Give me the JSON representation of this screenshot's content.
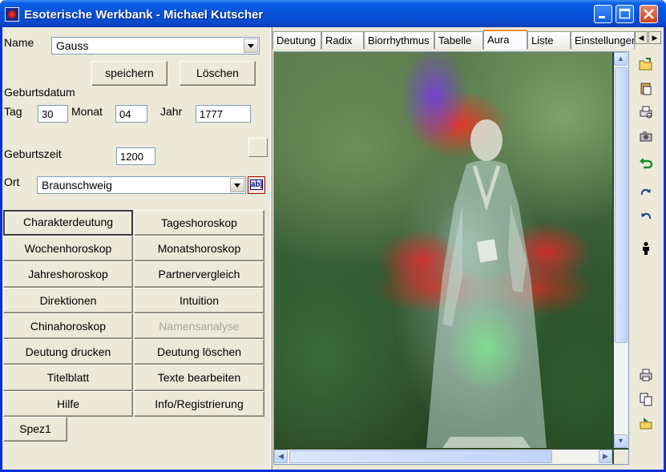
{
  "window": {
    "title": "Esoterische Werkbank - Michael Kutscher"
  },
  "form": {
    "name_label": "Name",
    "name_value": "Gauss",
    "save_label": "speichern",
    "delete_label": "Löschen",
    "birthdate_label": "Geburtsdatum",
    "day_label": "Tag",
    "day_value": "30",
    "month_label": "Monat",
    "month_value": "04",
    "year_label": "Jahr",
    "year_value": "1777",
    "birthtime_label": "Geburtszeit",
    "birthtime_value": "1200",
    "place_label": "Ort",
    "place_value": "Braunschweig",
    "ab_label": "ab|"
  },
  "actions": [
    {
      "label": "Charakterdeutung",
      "pressed": true
    },
    {
      "label": "Tageshoroskop"
    },
    {
      "label": "Wochenhoroskop"
    },
    {
      "label": "Monatshoroskop"
    },
    {
      "label": "Jahreshoroskop"
    },
    {
      "label": "Partnervergleich"
    },
    {
      "label": "Direktionen"
    },
    {
      "label": "Intuition"
    },
    {
      "label": "Chinahoroskop"
    },
    {
      "label": "Namensanalyse",
      "disabled": true
    },
    {
      "label": "Deutung drucken"
    },
    {
      "label": "Deutung löschen"
    },
    {
      "label": "Titelblatt"
    },
    {
      "label": "Texte bearbeiten"
    },
    {
      "label": "Hilfe"
    },
    {
      "label": "Info/Registrierung"
    },
    {
      "label": "Spez1"
    }
  ],
  "tabs": [
    {
      "label": "Deutung"
    },
    {
      "label": "Radix"
    },
    {
      "label": "Biorrhythmus"
    },
    {
      "label": "Tabelle"
    },
    {
      "label": "Aura",
      "active": true
    },
    {
      "label": "Liste"
    },
    {
      "label": "Einstellungen"
    }
  ],
  "toolbar_icons": [
    "open-folder-icon",
    "paste-icon",
    "print-preview-icon",
    "camera-icon",
    "undo-arrow-icon",
    "redo-icon",
    "undo-icon",
    "person-icon",
    "print-icon",
    "copy-icon",
    "export-icon"
  ],
  "colors": {
    "accent": "#0552d8",
    "tab_active_border": "#e68b2c",
    "aura_crown": "#7a3cdc",
    "aura_red": "#ff2820",
    "aura_green": "#28ff3c"
  }
}
